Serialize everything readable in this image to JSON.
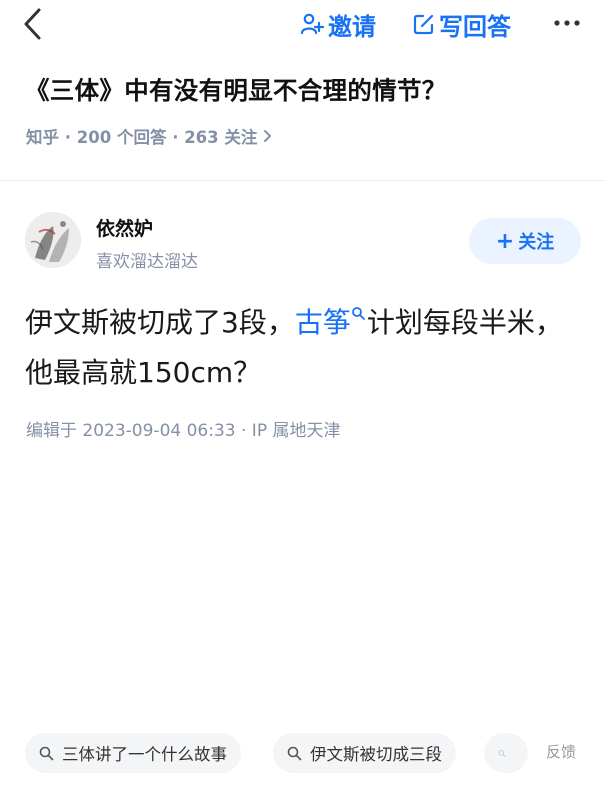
{
  "toolbar": {
    "invite_label": "邀请",
    "write_label": "写回答"
  },
  "question": {
    "title": "《三体》中有没有明显不合理的情节？",
    "meta": "知乎 · 200 个回答 · 263 关注"
  },
  "answer": {
    "author_name": "依然妒",
    "author_bio": "喜欢溜达溜达",
    "follow_label": "关注",
    "content_before": "伊文斯被切成了3段，",
    "content_link": "古筝",
    "content_after": "计划每段半米，他最高就150cm？",
    "edited": "编辑于 2023-09-04 06:33 · IP 属地天津"
  },
  "related_searches": {
    "items": [
      "三体讲了一个什么故事",
      "伊文斯被切成三段"
    ],
    "feedback_label": "反馈"
  },
  "colors": {
    "accent": "#1772f6",
    "muted": "#8590a6"
  }
}
